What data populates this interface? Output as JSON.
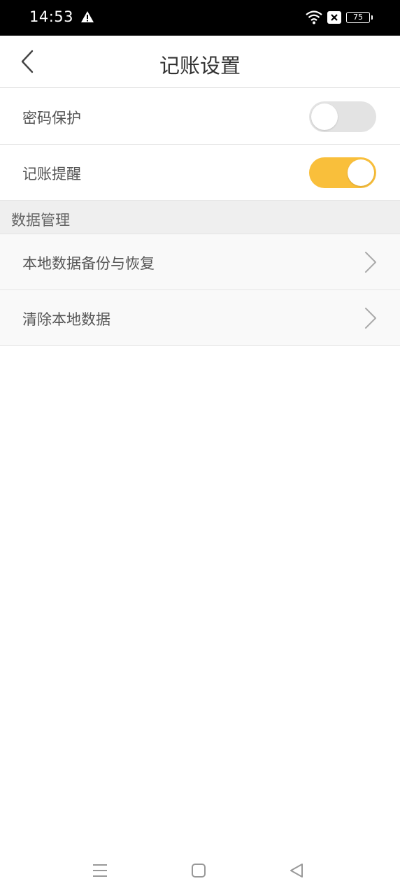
{
  "status_bar": {
    "time": "14:53",
    "battery": "75",
    "icons": [
      "warning-icon",
      "wifi-icon",
      "sim-no-signal-icon",
      "battery-icon"
    ]
  },
  "header": {
    "title": "记账设置",
    "back_icon": "chevron-left-icon"
  },
  "settings": {
    "password_protect": {
      "label": "密码保护",
      "enabled": false
    },
    "reminder": {
      "label": "记账提醒",
      "enabled": true
    }
  },
  "data_section": {
    "title": "数据管理",
    "items": [
      {
        "label": "本地数据备份与恢复"
      },
      {
        "label": "清除本地数据"
      }
    ]
  },
  "system_nav": {
    "icons": [
      "menu-icon",
      "home-icon",
      "back-triangle-icon"
    ]
  },
  "colors": {
    "accent": "#f9bf3b",
    "toggle_off": "#e3e3e3",
    "section_bg": "#efefef"
  }
}
